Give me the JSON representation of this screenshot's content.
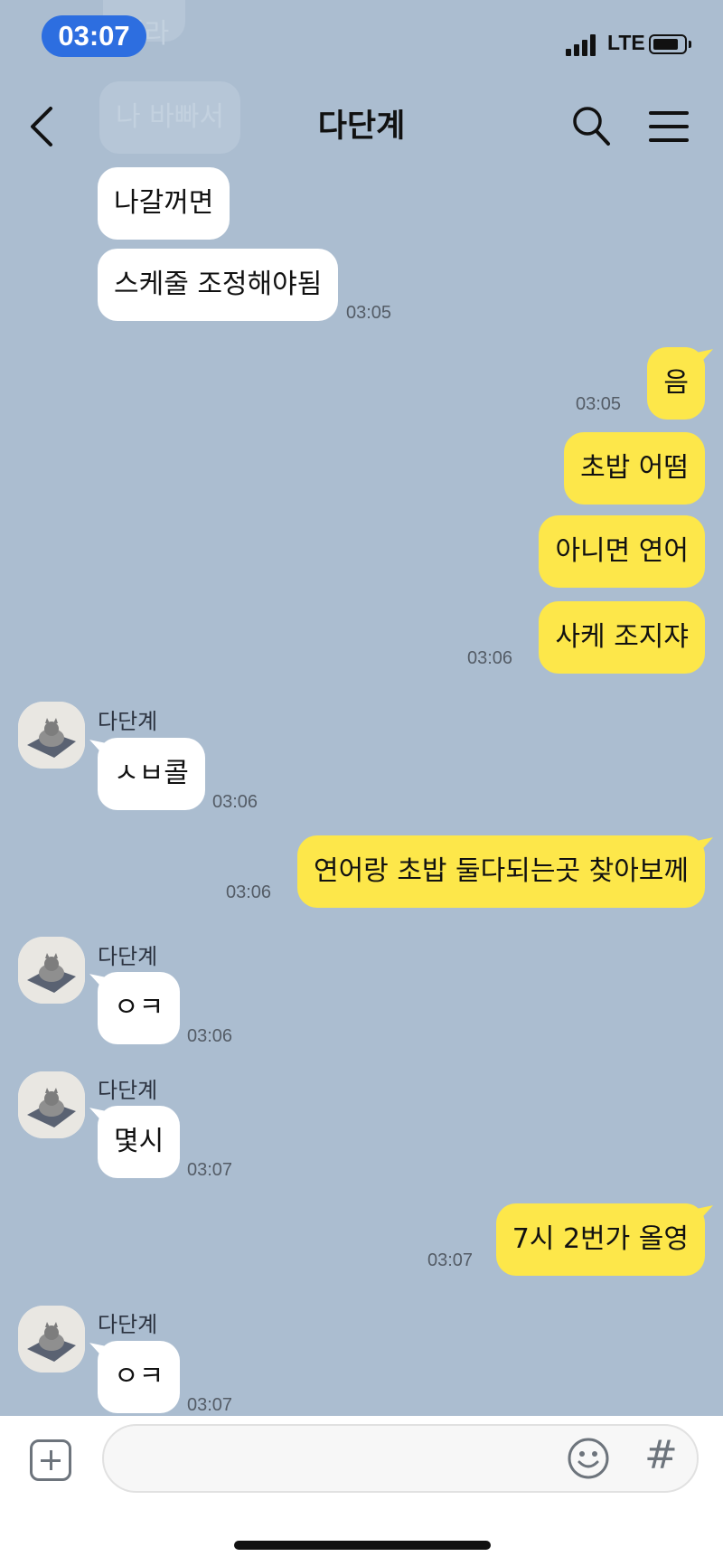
{
  "status_bar": {
    "time": "03:07",
    "network": "LTE"
  },
  "header": {
    "title": "다단계"
  },
  "ghost_messages": [
    "해라",
    "나 바빠서"
  ],
  "messages": [
    {
      "text": "나갈꺼면"
    },
    {
      "text": "스케줄 조정해야됨",
      "time": "03:05"
    },
    {
      "text": "음",
      "time": "03:05"
    },
    {
      "text": "초밥 어떰"
    },
    {
      "text": "아니면 연어"
    },
    {
      "text": "사케 조지쟈",
      "time": "03:06"
    },
    {
      "sender": "다단계",
      "text": "ㅅㅂ콜",
      "time": "03:06"
    },
    {
      "text": "연어랑 초밥 둘다되는곳 찾아보께",
      "time": "03:06"
    },
    {
      "sender": "다단계",
      "text": "ㅇㅋ",
      "time": "03:06"
    },
    {
      "sender": "다단계",
      "text": "몇시",
      "time": "03:07"
    },
    {
      "text": "7시 2번가 올영",
      "time": "03:07"
    },
    {
      "sender": "다단계",
      "text": "ㅇㅋ",
      "time": "03:07"
    }
  ],
  "input": {
    "value": "",
    "hash_symbol": "#"
  },
  "colors": {
    "background": "#abbdd0",
    "outgoing_bubble": "#fde74a",
    "incoming_bubble": "#ffffff",
    "time_badge": "#2d6ee0"
  },
  "icons": [
    "back-icon",
    "search-icon",
    "menu-icon",
    "plus-icon",
    "emoji-icon"
  ]
}
